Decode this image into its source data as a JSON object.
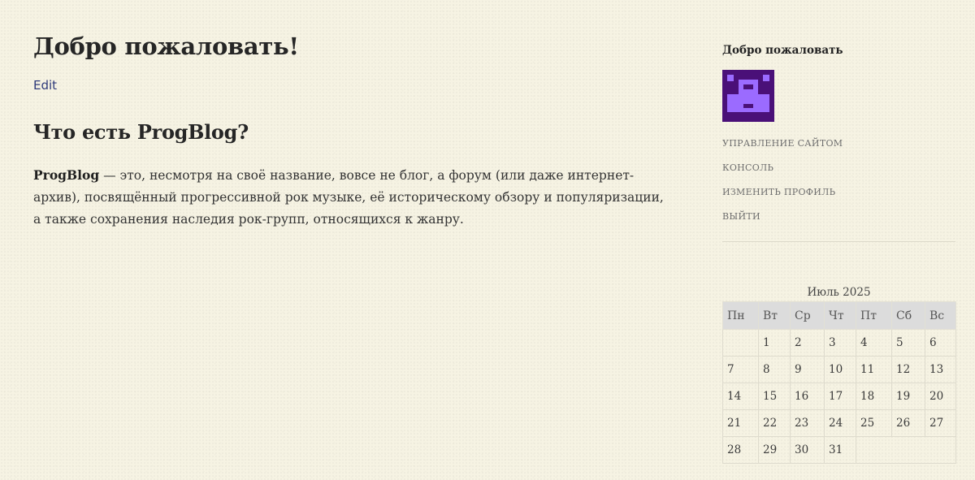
{
  "page": {
    "title": "Добро пожаловать!",
    "edit_label": "Edit",
    "section_heading": "Что есть ProgBlog?",
    "intro_bold": "ProgBlog",
    "intro_text": " — это, несмотря на своё название, вовсе не блог, а форум (или даже интернет-архив), посвящённый прогрессивной рок музыке, её историческому обзору и популяризации, а также сохранения наследия рок-групп, относящихся к жанру."
  },
  "sidebar": {
    "welcome_title": "Добро пожаловать",
    "avatar_colors": {
      "background": "#4a1078",
      "figure": "#9b6bff"
    },
    "links": [
      {
        "label": "УПРАВЛЕНИЕ САЙТОМ"
      },
      {
        "label": "КОНСОЛЬ"
      },
      {
        "label": "ИЗМЕНИТЬ ПРОФИЛЬ"
      },
      {
        "label": "ВЫЙТИ"
      }
    ]
  },
  "calendar": {
    "caption": "Июль 2025",
    "weekdays": [
      "Пн",
      "Вт",
      "Ср",
      "Чт",
      "Пт",
      "Сб",
      "Вс"
    ],
    "weeks": [
      [
        "",
        "1",
        "2",
        "3",
        "4",
        "5",
        "6"
      ],
      [
        "7",
        "8",
        "9",
        "10",
        "11",
        "12",
        "13"
      ],
      [
        "14",
        "15",
        "16",
        "17",
        "18",
        "19",
        "20"
      ],
      [
        "21",
        "22",
        "23",
        "24",
        "25",
        "26",
        "27"
      ],
      [
        "28",
        "29",
        "30",
        "31",
        "",
        "",
        ""
      ]
    ]
  }
}
